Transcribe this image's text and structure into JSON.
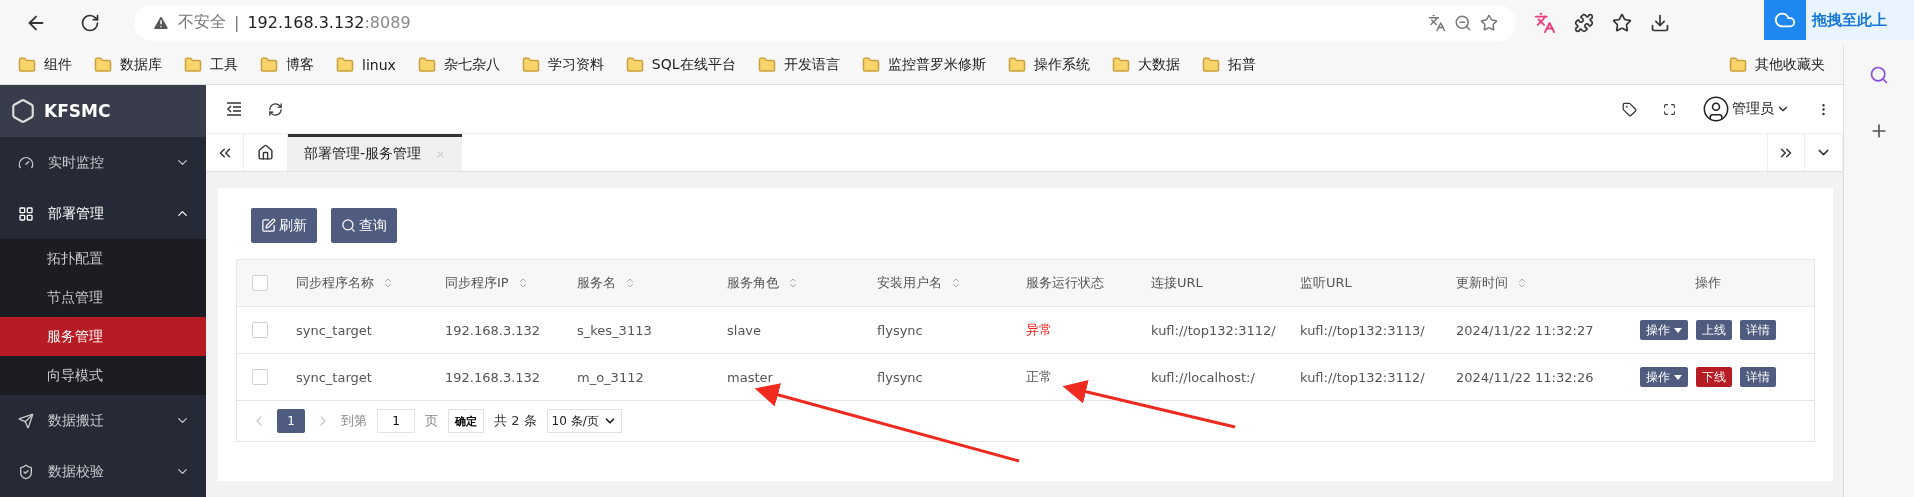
{
  "browser": {
    "security_label": "不安全",
    "separator": "|",
    "url_host": "192.168.3.132",
    "url_port": ":8089",
    "extension_badge": "拖拽至此上"
  },
  "bookmarks": [
    {
      "label": "组件"
    },
    {
      "label": "数据库"
    },
    {
      "label": "工具"
    },
    {
      "label": "博客"
    },
    {
      "label": "linux"
    },
    {
      "label": "杂七杂八"
    },
    {
      "label": "学习资料"
    },
    {
      "label": "SQL在线平台"
    },
    {
      "label": "开发语言"
    },
    {
      "label": "监控普罗米修斯"
    },
    {
      "label": "操作系统"
    },
    {
      "label": "大数据"
    },
    {
      "label": "拓普"
    }
  ],
  "other_bookmarks": {
    "label": "其他收藏夹"
  },
  "app": {
    "brand": "KFSMC",
    "user": "管理员"
  },
  "sidebar": {
    "items": [
      {
        "label": "实时监控",
        "kind": "gauge",
        "expanded": false
      },
      {
        "label": "部署管理",
        "kind": "grid",
        "expanded": true,
        "children": [
          {
            "label": "拓扑配置",
            "selected": false
          },
          {
            "label": "节点管理",
            "selected": false
          },
          {
            "label": "服务管理",
            "selected": true
          },
          {
            "label": "向导模式",
            "selected": false
          }
        ]
      },
      {
        "label": "数据搬迁",
        "kind": "send",
        "expanded": false
      },
      {
        "label": "数据校验",
        "kind": "shield",
        "expanded": false
      }
    ]
  },
  "tabs": [
    {
      "label": "部署管理-服务管理",
      "selected": true
    }
  ],
  "toolbar_buttons": [
    {
      "label": "刷新",
      "kind": "edit"
    },
    {
      "label": "查询",
      "kind": "search"
    }
  ],
  "table": {
    "select_all_checked": false,
    "columns": [
      {
        "label": "同步程序名称",
        "sortable": true
      },
      {
        "label": "同步程序IP",
        "sortable": true
      },
      {
        "label": "服务名",
        "sortable": true
      },
      {
        "label": "服务角色",
        "sortable": true
      },
      {
        "label": "安装用户名",
        "sortable": true
      },
      {
        "label": "服务运行状态",
        "sortable": false
      },
      {
        "label": "连接URL",
        "sortable": false
      },
      {
        "label": "监听URL",
        "sortable": false
      },
      {
        "label": "更新时间",
        "sortable": true
      },
      {
        "label": "操作",
        "sortable": false
      }
    ],
    "rows": [
      {
        "checked": false,
        "cells": [
          "sync_target",
          "192.168.3.132",
          "s_kes_3113",
          "slave",
          "flysync"
        ],
        "status": {
          "text": "异常",
          "alert": true
        },
        "urls": [
          "kufl://top132:3112/",
          "kufl://top132:3113/",
          "2024/11/22 11:32:27"
        ],
        "actions": [
          {
            "label": "操作",
            "kind": "dropdown"
          },
          {
            "label": "上线",
            "kind": "online"
          },
          {
            "label": "详情",
            "kind": "detail"
          }
        ]
      },
      {
        "checked": false,
        "cells": [
          "sync_target",
          "192.168.3.132",
          "m_o_3112",
          "master",
          "flysync"
        ],
        "status": {
          "text": "正常",
          "alert": false
        },
        "urls": [
          "kufl://localhost:/",
          "kufl://top132:3112/",
          "2024/11/22 11:32:26"
        ],
        "actions": [
          {
            "label": "操作",
            "kind": "dropdown"
          },
          {
            "label": "下线",
            "kind": "offline"
          },
          {
            "label": "详情",
            "kind": "detail"
          }
        ]
      }
    ]
  },
  "pagination": {
    "pages": [
      {
        "label": "1",
        "selected": true
      }
    ],
    "goto_label": "到第",
    "goto_value": "1",
    "page_unit": "页",
    "confirm": "确定",
    "total": "共 2 条",
    "page_size": "10 条/页"
  }
}
